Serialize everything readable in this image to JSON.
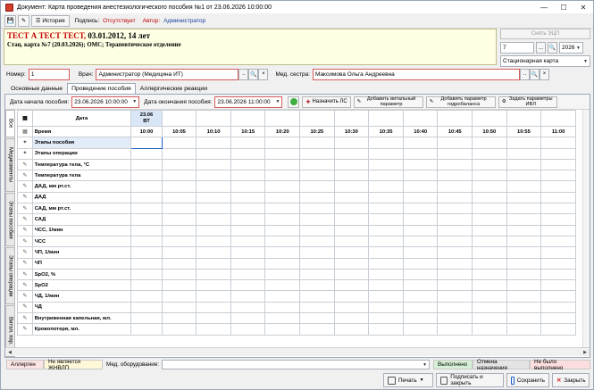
{
  "window": {
    "title": "Документ: Карта проведения анестезиологического пособия №1 от 23.06.2026 10:00:00"
  },
  "toolbar1": {
    "history_label": "История",
    "sign_label": "Подпись:",
    "sign_value": "Отсутствует",
    "author_label": "Автор:",
    "author_value": "Администратор"
  },
  "patient": {
    "name": "ТЕСТ А ТЕСТ ТЕСТ,",
    "info": "03.01.2012, 14 лет",
    "card": "Стац. карта №7 (20.03.2026); ОМС; Терапевтическое отделение"
  },
  "right": {
    "sign_ecp": "Снять ЭЦП",
    "num": "7",
    "year": "2026",
    "card_type": "Стационарная карта"
  },
  "staff": {
    "number_label": "Номер:",
    "number_value": "1",
    "doctor_label": "Врач:",
    "doctor_value": "Администратор (Медицина ИТ)",
    "nurse_label": "Мед. сестра:",
    "nurse_value": "Максимова Ольга Андреевна"
  },
  "tabs": [
    "Основные данные",
    "Проведение пособия",
    "Аллергические реакции"
  ],
  "toolbar2": {
    "start_label": "Дата начала пособия:",
    "start_value": "23.06.2026 10:00:00",
    "end_label": "Дата окончания пособия:",
    "end_value": "23.06.2026 11:00:00",
    "btn_ls": "Назначить ЛС",
    "btn_vital": "Добавить витальный параметр",
    "btn_hydro": "Добавить параметр гидробаланса",
    "btn_ivl": "Задать параметры ИВЛ"
  },
  "vtabs": [
    "Все",
    "Медикаменты",
    "Этапы пособия",
    "Этапы операции",
    "Витал. пар."
  ],
  "grid": {
    "date_header": "Дата",
    "date_value": "23.06",
    "day_value": "ВТ",
    "time_header": "Время",
    "times": [
      "10:00",
      "10:05",
      "10:10",
      "10:15",
      "10:20",
      "10:25",
      "10:30",
      "10:35",
      "10:40",
      "10:45",
      "10:50",
      "10:55",
      "11:00"
    ],
    "rows": [
      "Этапы пособия",
      "Этапы операции",
      "Температура тела, °С",
      "Температура тела",
      "ДАД, мм рт.ст.",
      "ДАД",
      "САД, мм рт.ст.",
      "САД",
      "ЧСС, 1/мин",
      "ЧСС",
      "ЧП, 1/мин",
      "ЧП",
      "SpO2, %",
      "SpO2",
      "ЧД, 1/мин",
      "ЧД",
      "Внутривенная капельная, мл.",
      "Кровопотеря, мл."
    ]
  },
  "legend": {
    "allergy": "Аллерген",
    "not_vital": "Не является ЖНВЛП",
    "equip_label": "Мед. оборудование:",
    "done": "Выполнено",
    "cancelled": "Отмена назначения",
    "not_done": "Не было выполнено"
  },
  "footer": {
    "print": "Печать",
    "sign_close": "Подписать и закрыть",
    "save": "Сохранить",
    "close": "Закрыть"
  },
  "colors": {
    "allergy_bg": "#fce4e4",
    "not_vital_bg": "#fff8d8",
    "done_bg": "#d6f0d6",
    "cancelled_bg": "#e4e4e4",
    "not_done_bg": "#fcdede"
  }
}
